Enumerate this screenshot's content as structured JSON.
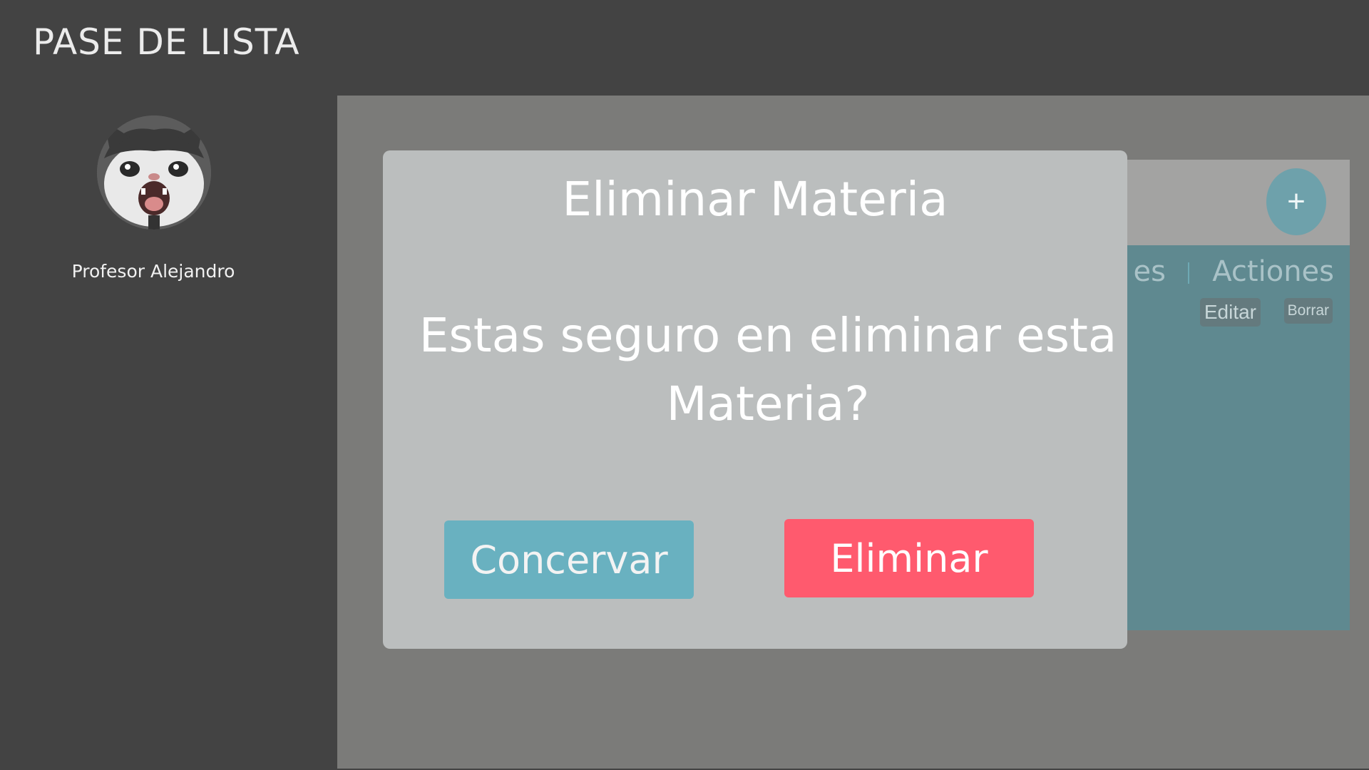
{
  "header": {
    "title": "PASE DE LISTA"
  },
  "sidebar": {
    "profile_name": "Profesor Alejandro",
    "avatar_icon": "cat-avatar-image"
  },
  "main": {
    "add_label": "+",
    "columns": [
      "es",
      "Actiones"
    ],
    "row": {
      "edit_label": "Editar",
      "delete_label": "Borrar"
    }
  },
  "modal": {
    "title": "Eliminar Materia",
    "message": "Estas seguro en eliminar esta Materia?",
    "keep_label": "Concervar",
    "delete_label": "Eliminar"
  },
  "colors": {
    "background": "#434343",
    "overlay": "#7b7b79",
    "modal": "#bbbebe",
    "keep_button": "#69b1c0",
    "delete_button": "#ff5a6e"
  }
}
